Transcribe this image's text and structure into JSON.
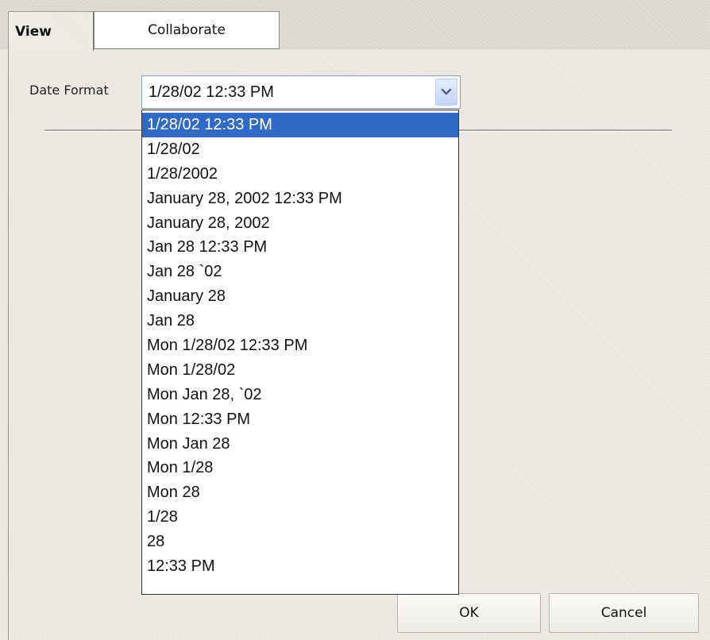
{
  "tabs": [
    {
      "label": "View",
      "active": true
    },
    {
      "label": "Collaborate",
      "active": false
    }
  ],
  "date_format": {
    "label": "Date Format",
    "selected_value": "1/28/02 12:33 PM",
    "options": [
      "1/28/02 12:33 PM",
      "1/28/02",
      "1/28/2002",
      "January 28, 2002 12:33 PM",
      "January 28, 2002",
      "Jan 28 12:33 PM",
      "Jan 28 `02",
      "January 28",
      "Jan 28",
      "Mon 1/28/02 12:33 PM",
      "Mon 1/28/02",
      "Mon Jan 28, `02",
      "Mon 12:33 PM",
      "Mon Jan 28",
      "Mon 1/28",
      "Mon 28",
      "1/28",
      "28",
      "12:33 PM"
    ],
    "highlighted_index": 0
  },
  "buttons": {
    "ok_label": "OK",
    "cancel_label": "Cancel"
  },
  "colors": {
    "highlight": "#316ac5",
    "dropdown_arrow": "#4d6185"
  },
  "icons": {
    "dropdown": "chevron-down-icon"
  }
}
